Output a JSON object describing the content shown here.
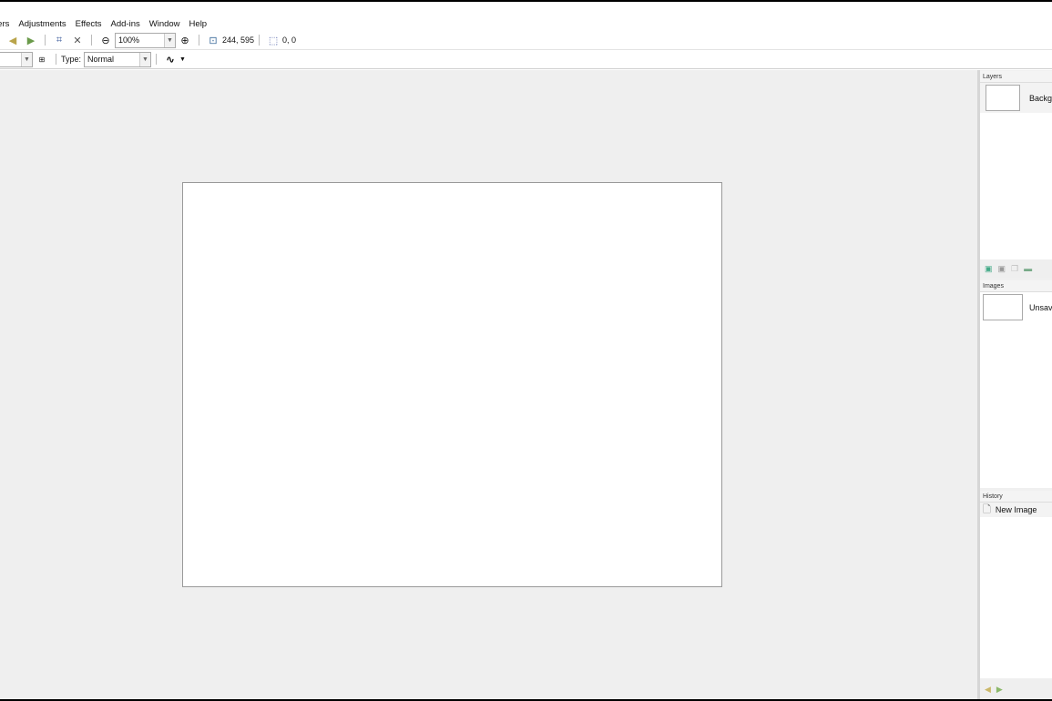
{
  "menu": [
    "rers",
    "Adjustments",
    "Effects",
    "Add-ins",
    "Window",
    "Help"
  ],
  "toolbar": {
    "zoom_value": "100%",
    "cursor_position": "244, 595",
    "selection_size": "0, 0"
  },
  "toolbar2": {
    "type_label": "Type:",
    "type_value": "Normal"
  },
  "panels": {
    "layers": {
      "title": "Layers",
      "items": [
        "Backg"
      ]
    },
    "images": {
      "title": "Images",
      "items": [
        "Unsav"
      ]
    },
    "history": {
      "title": "History",
      "items": [
        "New Image"
      ]
    }
  }
}
